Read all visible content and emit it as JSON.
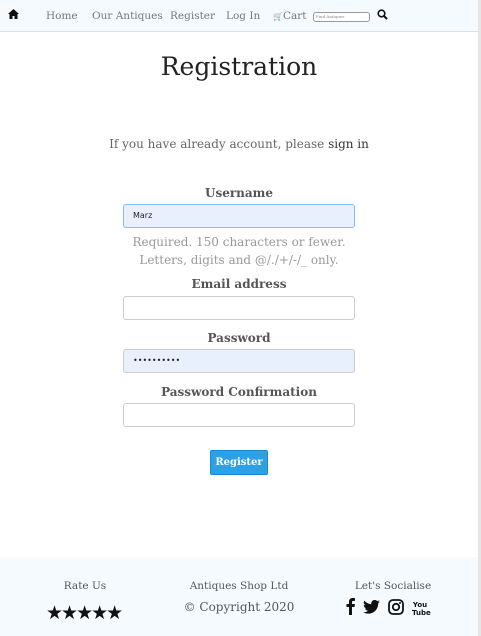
{
  "nav": {
    "home_icon": "home-icon",
    "items": [
      "Home",
      "Our Antiques",
      "Register",
      "Log In"
    ],
    "cart": "Cart",
    "search_placeholder": "Find Antiques"
  },
  "page": {
    "title": "Registration",
    "signin_prefix": "If you have already account, please ",
    "signin_link": "sign in"
  },
  "form": {
    "username_label": "Username",
    "username_value": "Marz",
    "help1": "Required. 150 characters or fewer.",
    "help2": "Letters, digits and @/./+/-/_ only.",
    "email_label": "Email address",
    "email_value": "",
    "password_label": "Password",
    "password_value": "••••••••••",
    "confirm_label": "Password Confirmation",
    "confirm_value": "",
    "submit": "Register"
  },
  "footer": {
    "rate": "Rate Us",
    "stars": 5,
    "star_glyphs": "★★★★★",
    "company": "Antiques Shop Ltd",
    "copyright": "© Copyright 2020",
    "social": "Let's Socialise",
    "youtube": "You Tube"
  }
}
